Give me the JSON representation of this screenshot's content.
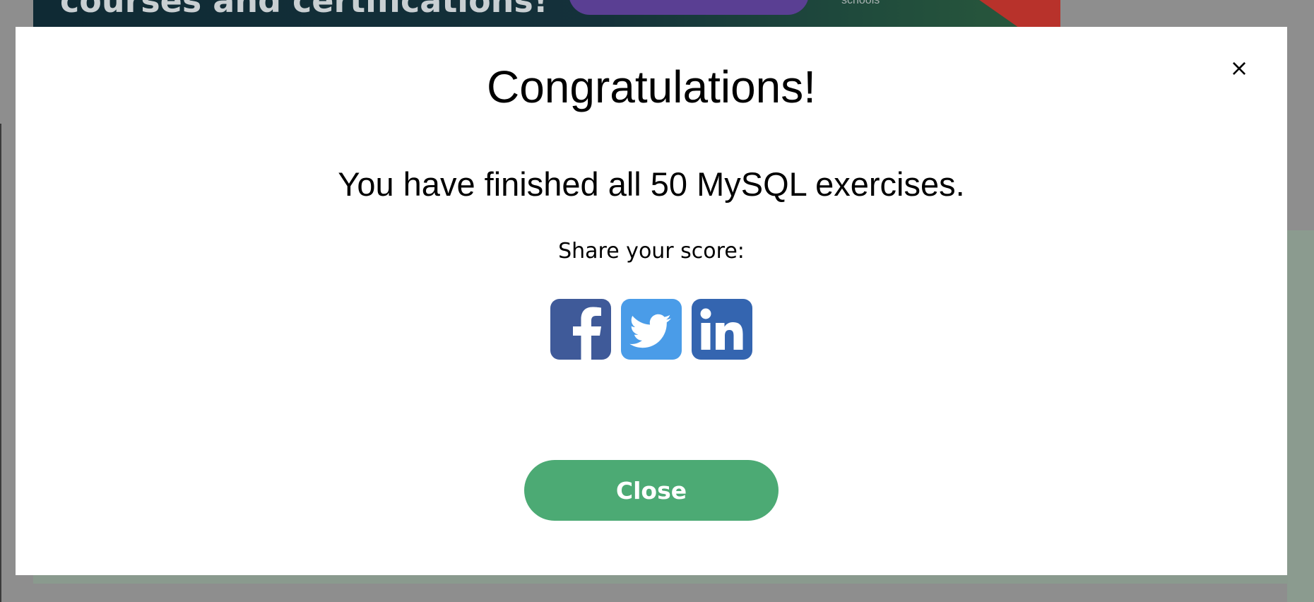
{
  "background": {
    "banner_text": "courses and certifications!",
    "banner_schools_text": "schools"
  },
  "modal": {
    "title": "Congratulations!",
    "message": "You have finished all 50 MySQL exercises.",
    "share_label": "Share your score:",
    "share_buttons": [
      {
        "name": "facebook",
        "icon": "facebook-icon",
        "color": "#3f5a99"
      },
      {
        "name": "twitter",
        "icon": "twitter-icon",
        "color": "#4a9ce8"
      },
      {
        "name": "linkedin",
        "icon": "linkedin-icon",
        "color": "#3465b0"
      }
    ],
    "close_icon": "close-icon",
    "close_symbol": "×",
    "close_button_label": "Close",
    "close_button_color": "#4caa74"
  }
}
